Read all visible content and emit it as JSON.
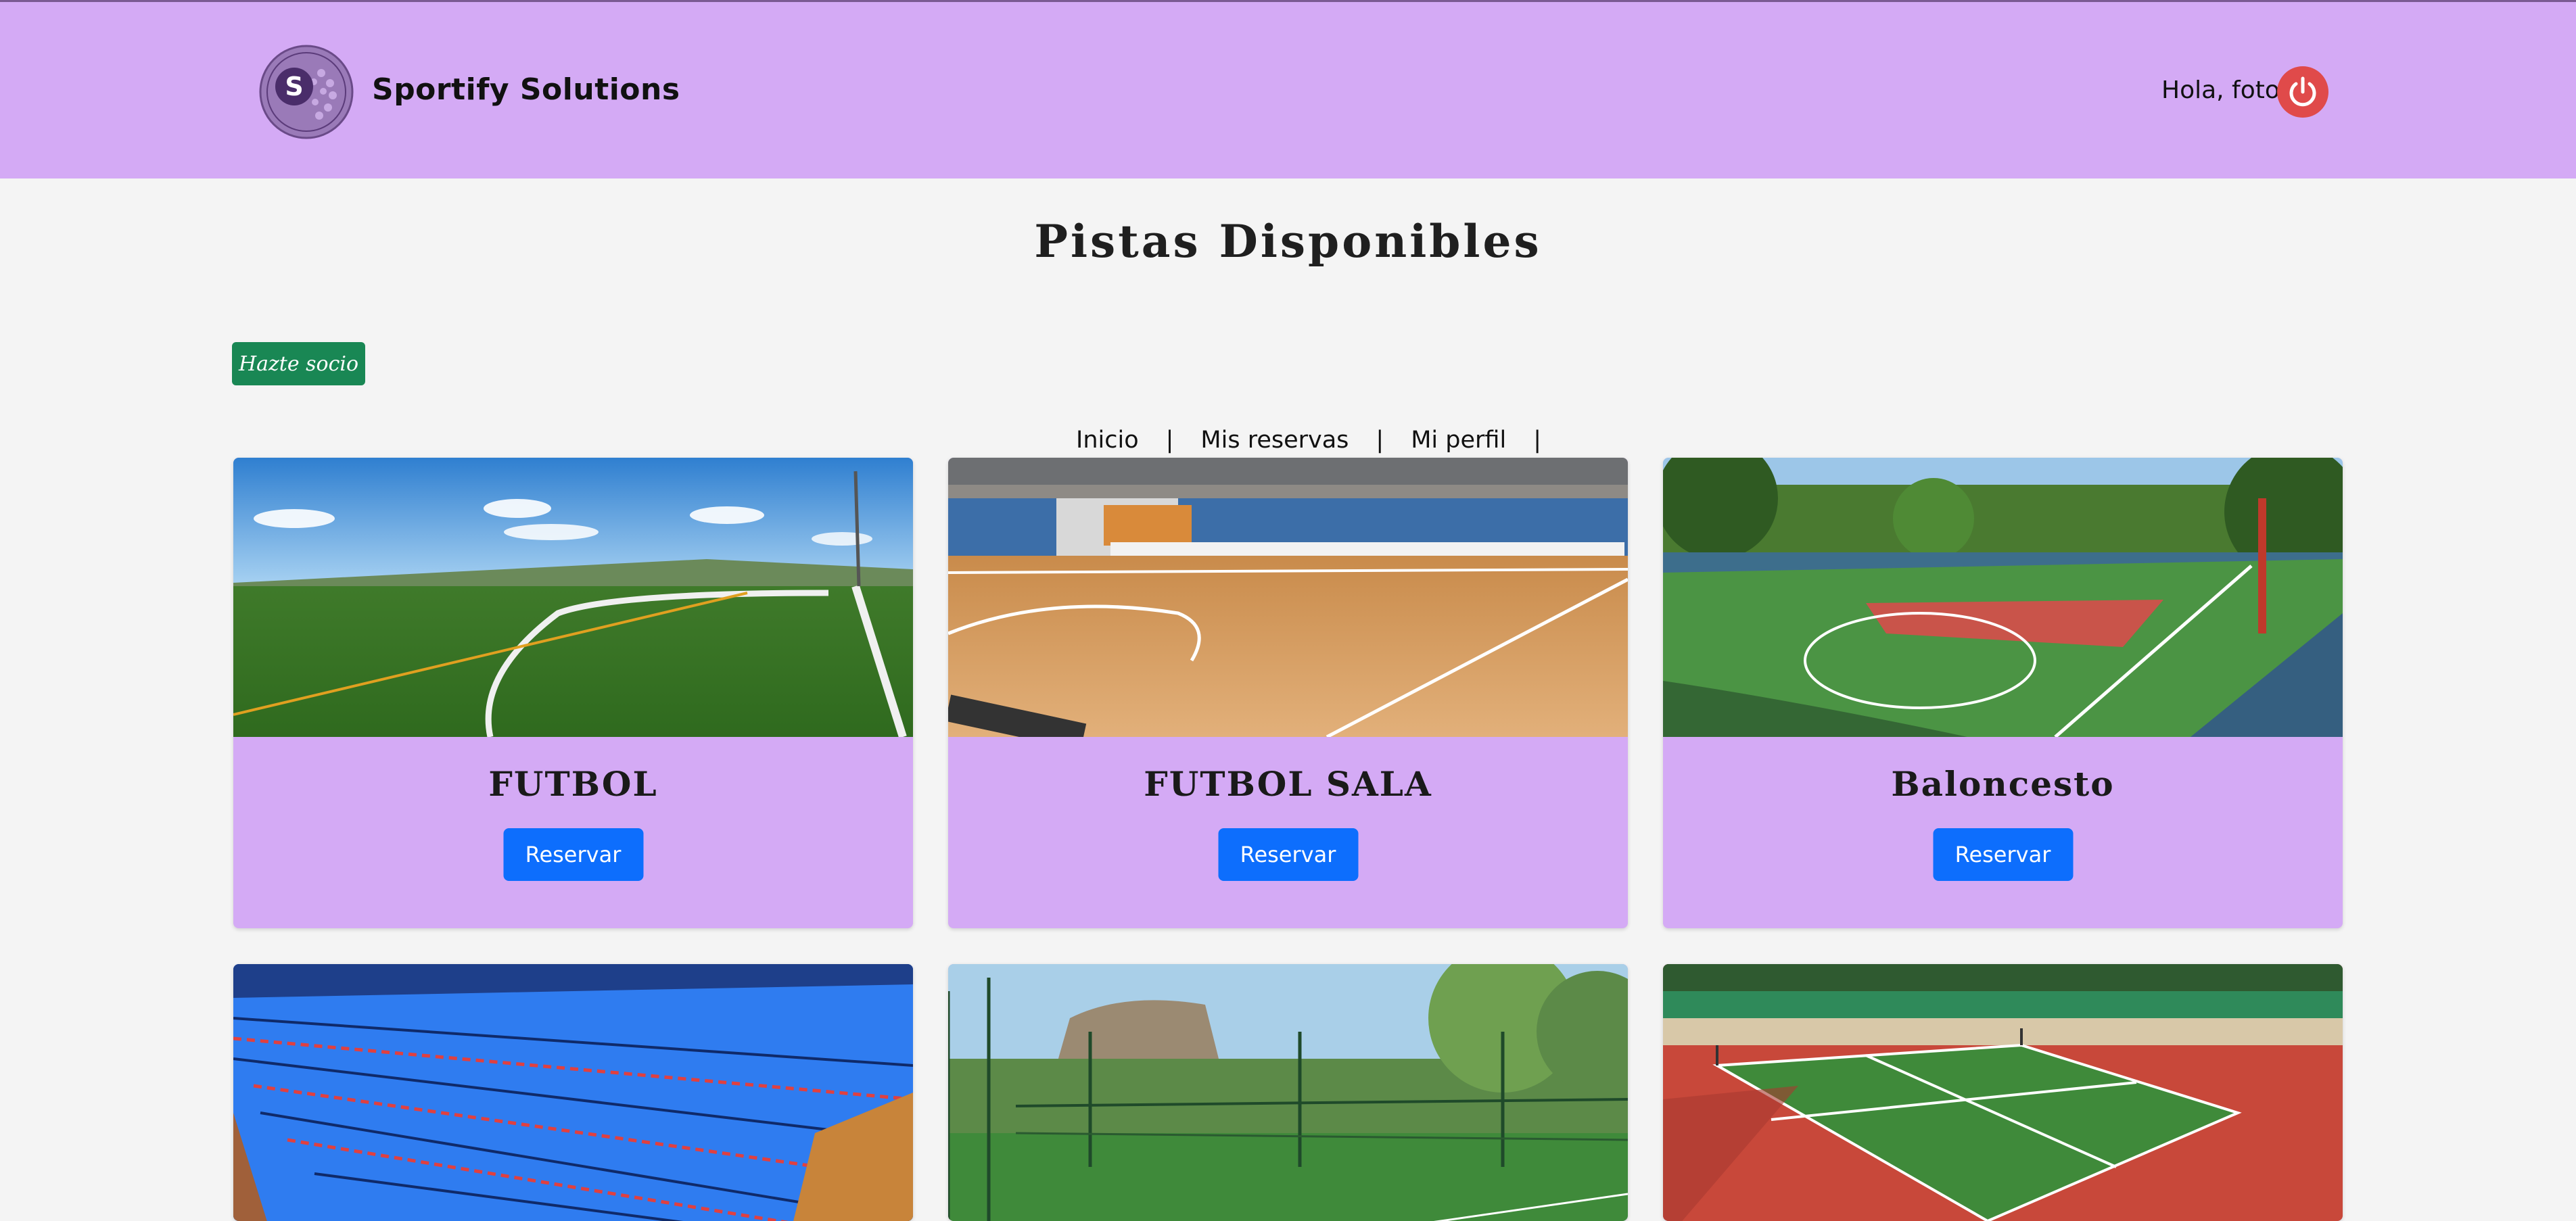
{
  "header": {
    "brand": "Sportify Solutions",
    "logo_letter": "S",
    "greeting": "Hola, foto",
    "logout_icon": "power-icon",
    "background": "#d4aaf5"
  },
  "page": {
    "title": "Pistas Disponibles",
    "socio_button": "Hazte socio"
  },
  "nav": {
    "items": [
      "Inicio",
      "Mis reservas",
      "Mi perfil"
    ],
    "separator": "|"
  },
  "courts": [
    {
      "name": "FUTBOL",
      "button": "Reservar",
      "image": "grass-football-field"
    },
    {
      "name": "FUTBOL SALA",
      "button": "Reservar",
      "image": "indoor-wood-court"
    },
    {
      "name": "Baloncesto",
      "button": "Reservar",
      "image": "outdoor-basketball-court"
    },
    {
      "name": "",
      "button": "",
      "image": "swimming-pool"
    },
    {
      "name": "",
      "button": "",
      "image": "padel-court"
    },
    {
      "name": "",
      "button": "",
      "image": "tennis-court"
    }
  ],
  "colors": {
    "primary_button": "#0d6efd",
    "socio_button": "#198754",
    "logout": "#e04a4a",
    "card_body": "#d4aaf5"
  }
}
